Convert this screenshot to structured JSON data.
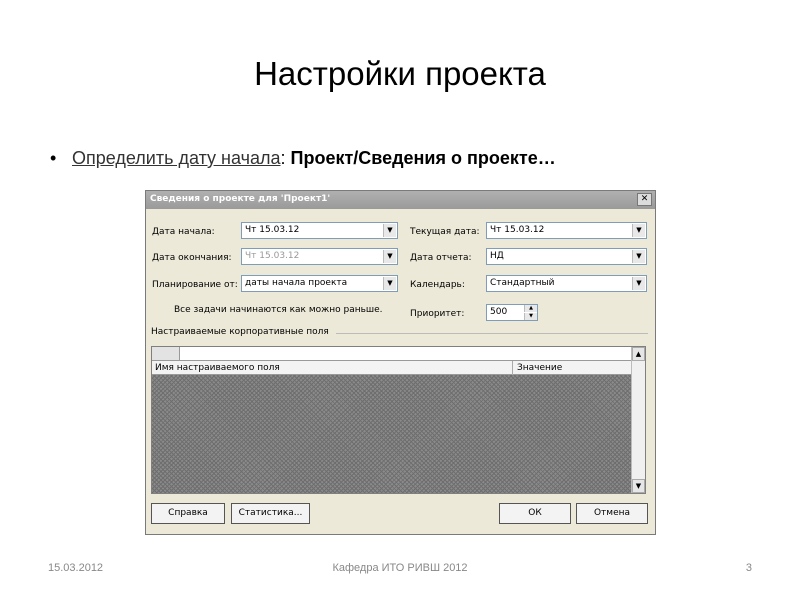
{
  "slide": {
    "title": "Настройки проекта",
    "bullet": {
      "marker": "•",
      "link_text": "Определить дату начала",
      "separator": ": ",
      "rest_text": "Проект/Сведения о проекте…"
    },
    "footer": {
      "date": "15.03.2012",
      "center": "Кафедра ИТО РИВШ 2012",
      "page": "3"
    }
  },
  "dialog": {
    "title": "Сведения о проекте для 'Проект1'",
    "close_glyph": "✕",
    "fields": {
      "start_date": {
        "label": "Дата начала:",
        "value": "Чт 15.03.12"
      },
      "finish_date": {
        "label": "Дата окончания:",
        "value": "Чт 15.03.12"
      },
      "schedule_from": {
        "label": "Планирование от:",
        "value": "даты начала проекта"
      },
      "current_date": {
        "label": "Текущая дата:",
        "value": "Чт 15.03.12"
      },
      "status_date": {
        "label": "Дата отчета:",
        "value": "НД"
      },
      "calendar": {
        "label": "Календарь:",
        "value": "Стандартный"
      },
      "priority": {
        "label": "Приоритет:",
        "value": "500"
      }
    },
    "info_text": "Все задачи начинаются как можно раньше.",
    "custom_fields_label": "Настраиваемые корпоративные поля",
    "grid": {
      "col_name": "Имя настраиваемого поля",
      "col_value": "Значение"
    },
    "buttons": {
      "help": "Справка",
      "statistics": "Статистика...",
      "ok": "ОК",
      "cancel": "Отмена"
    },
    "icons": {
      "dropdown": "▼",
      "spin_up": "▲",
      "spin_down": "▼",
      "scroll_up": "▲",
      "scroll_down": "▼"
    }
  }
}
